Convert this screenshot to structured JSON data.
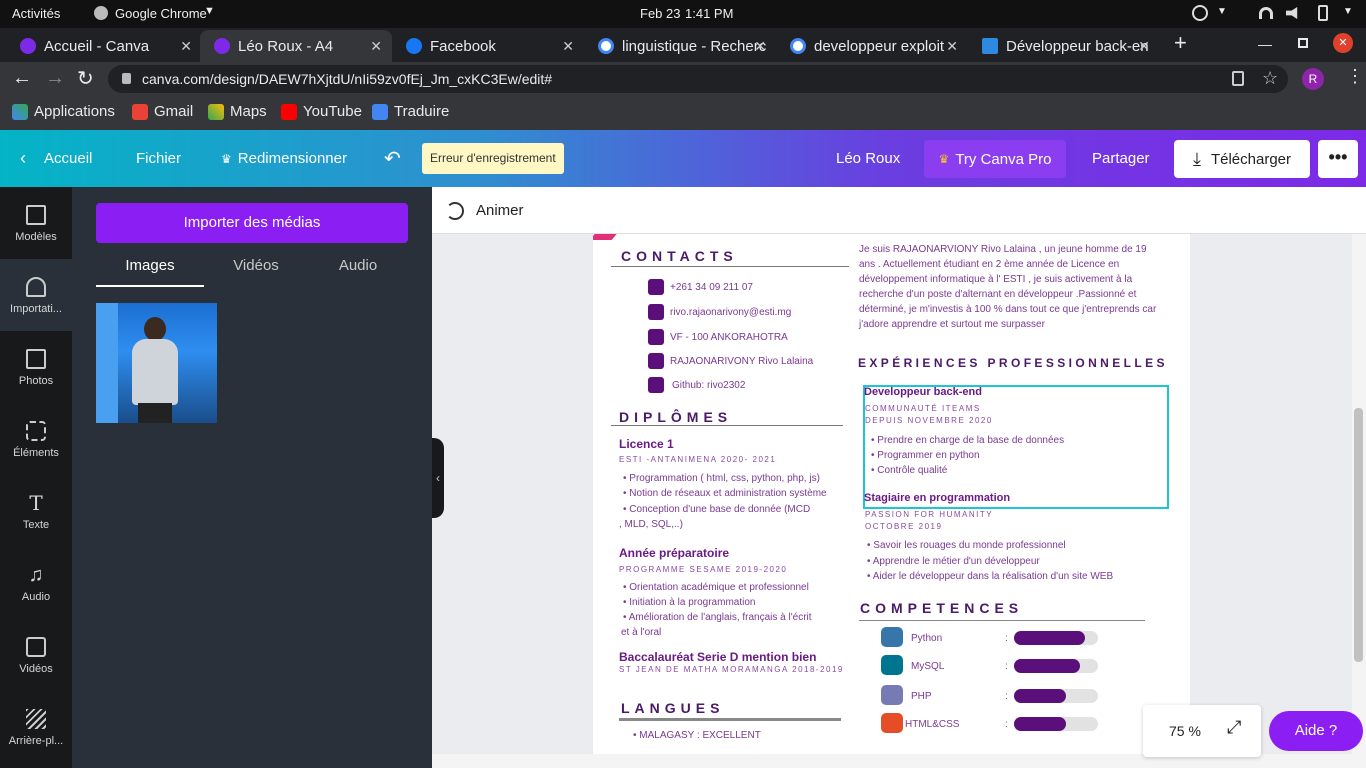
{
  "system": {
    "activities": "Activités",
    "app": "Google Chrome",
    "date": "Feb 23",
    "time": "1:41 PM"
  },
  "tabs": [
    {
      "label": "Accueil - Canva"
    },
    {
      "label": "Léo Roux - A4"
    },
    {
      "label": "Facebook"
    },
    {
      "label": "linguistique - Recherc"
    },
    {
      "label": "developpeur exploit"
    },
    {
      "label": "Développeur back-en"
    }
  ],
  "address": {
    "url": "canva.com/design/DAEW7hXjtdU/nIi59zv0fEj_Jm_cxKC3Ew/edit#",
    "profile": "R"
  },
  "bookmarks": [
    "Applications",
    "Gmail",
    "Maps",
    "YouTube",
    "Traduire"
  ],
  "header": {
    "home": "Accueil",
    "file": "Fichier",
    "resize": "Redimensionner",
    "save_error": "Erreur d'enregistrement",
    "doc_name": "Léo Roux",
    "try_pro": "Try Canva Pro",
    "share": "Partager",
    "download": "Télécharger"
  },
  "sidebar": [
    {
      "label": "Modèles",
      "icon": "templates-icon"
    },
    {
      "label": "Importati...",
      "icon": "upload-icon"
    },
    {
      "label": "Photos",
      "icon": "photos-icon"
    },
    {
      "label": "Éléments",
      "icon": "elements-icon"
    },
    {
      "label": "Texte",
      "icon": "text-icon"
    },
    {
      "label": "Audio",
      "icon": "audio-icon"
    },
    {
      "label": "Vidéos",
      "icon": "videos-icon"
    },
    {
      "label": "Arrière-pl...",
      "icon": "background-icon"
    }
  ],
  "panel": {
    "import_button": "Importer des médias",
    "tabs": [
      "Images",
      "Vidéos",
      "Audio"
    ],
    "active_tab": "Images"
  },
  "editor": {
    "animate": "Animer",
    "zoom": "75 %",
    "help": "Aide ?"
  },
  "cv": {
    "contacts_title": "CONTACTS",
    "contacts": [
      "+261 34 09 211 07",
      "rivo.rajaonarivony@esti.mg",
      "VF -  100 ANKORAHOTRA",
      "RAJAONARIVONY Rivo Lalaina",
      "Github: rivo2302"
    ],
    "about": "Je suis RAJAONARVIONY Rivo Lalaina , un jeune homme de 19 ans . Actuellement étudiant en 2 ème année de Licence en développement informatique à l' ESTI , je suis activement à la recherche d'un poste d'alternant en développeur .Passionné et déterminé, je m'investis à 100 % dans tout ce que j'entreprends car j'adore apprendre et surtout me surpasser",
    "diplomas_title": "DIPLÔMES",
    "diplomas": [
      {
        "title": "Licence 1",
        "sub": "ESTI -ANTANIMENA 2020- 2021",
        "items": [
          "Programmation ( html, css,  python, php, js)",
          "Notion de réseaux et administration système",
          "Conception d'une base de donnée (MCD",
          ", MLD, SQL,..)"
        ]
      },
      {
        "title": "Année préparatoire",
        "sub": "PROGRAMME SESAME 2019-2020",
        "items": [
          "Orientation académique et professionnel",
          "Initiation à la programmation",
          "Amélioration de l'anglais, français à l'écrit",
          "et à l'oral"
        ]
      },
      {
        "title": "Baccalauréat Serie D mention bien",
        "sub": "ST JEAN DE MATHA MORAMANGA 2018-2019",
        "items": []
      }
    ],
    "languages_title": "LANGUES",
    "languages": [
      "MALAGASY  :  EXCELLENT"
    ],
    "experience_title": "EXPÉRIENCES PROFESSIONNELLES",
    "experiences": [
      {
        "title": "Developpeur  back-end",
        "company": "COMMUNAUTÉ ITEAMS",
        "date": "DEPUIS NOVEMBRE 2020",
        "items": [
          "Prendre en charge de la base de données",
          "Programmer en python",
          "Contrôle qualité"
        ]
      },
      {
        "title": "Stagiaire en programmation",
        "company": "PASSION FOR HUMANITY",
        "date": "OCTOBRE 2019",
        "items": [
          "Savoir les rouages du monde professionnel",
          "Apprendre le métier d'un développeur",
          "Aider le développeur dans la réalisation d'un site WEB"
        ]
      }
    ],
    "skills_title": "COMPETENCES",
    "skills": [
      {
        "name": "Python",
        "level": 0.85
      },
      {
        "name": "MySQL",
        "level": 0.78
      },
      {
        "name": "PHP",
        "level": 0.62
      },
      {
        "name": "HTML&CSS",
        "level": 0.62
      }
    ]
  }
}
